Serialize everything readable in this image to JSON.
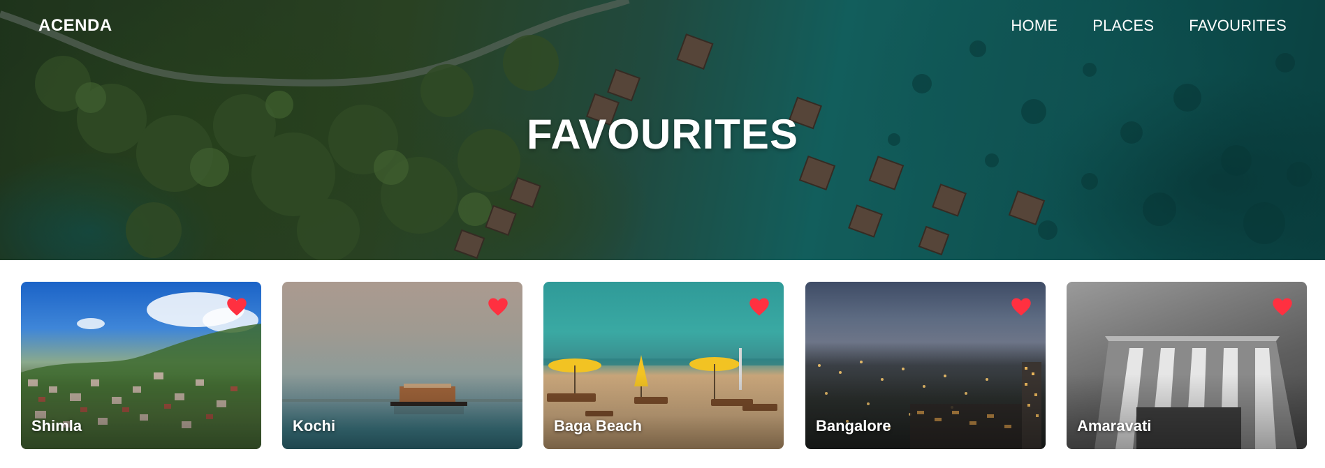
{
  "header": {
    "brand": "ACENDA",
    "nav": [
      {
        "label": "HOME"
      },
      {
        "label": "PLACES"
      },
      {
        "label": "FAVOURITES"
      }
    ]
  },
  "hero": {
    "title": "FAVOURITES"
  },
  "favourites": [
    {
      "name": "Shimla",
      "favourited": true
    },
    {
      "name": "Kochi",
      "favourited": true
    },
    {
      "name": "Baga Beach",
      "favourited": true
    },
    {
      "name": "Bangalore",
      "favourited": true
    },
    {
      "name": "Amaravati",
      "favourited": true
    }
  ],
  "colors": {
    "heart": "#ff3040",
    "text": "#ffffff"
  },
  "icons": {
    "favourite": "heart-icon"
  }
}
